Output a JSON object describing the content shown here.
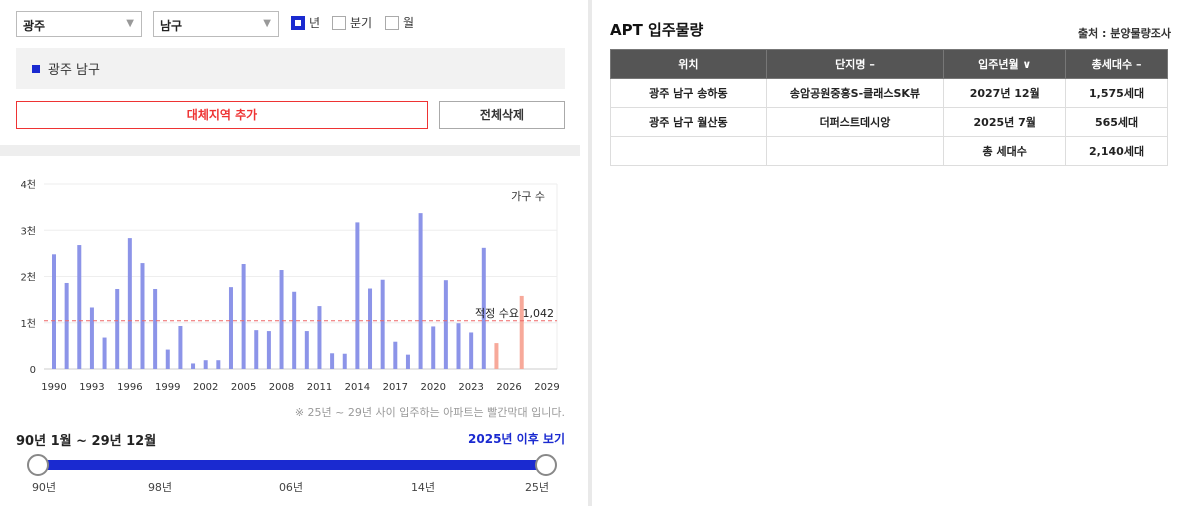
{
  "filters": {
    "province": "광주",
    "district": "남구",
    "period_options": [
      {
        "label": "년",
        "checked": true
      },
      {
        "label": "분기",
        "checked": false
      },
      {
        "label": "월",
        "checked": false
      }
    ]
  },
  "selected_region": "광주 남구",
  "buttons": {
    "add_region": "대체지역 추가",
    "delete_all": "전체삭제"
  },
  "chart_data": {
    "type": "bar",
    "ylabel": "가구 수",
    "yticks": [
      "0",
      "1천",
      "2천",
      "3천",
      "4천"
    ],
    "ylim": [
      0,
      4000
    ],
    "xticks": [
      "1990",
      "1993",
      "1996",
      "1999",
      "2002",
      "2005",
      "2008",
      "2011",
      "2014",
      "2017",
      "2020",
      "2023",
      "2026",
      "2029"
    ],
    "x": [
      1990,
      1991,
      1992,
      1993,
      1994,
      1995,
      1996,
      1997,
      1998,
      1999,
      2000,
      2001,
      2002,
      2003,
      2004,
      2005,
      2006,
      2007,
      2008,
      2009,
      2010,
      2011,
      2012,
      2013,
      2014,
      2015,
      2016,
      2017,
      2018,
      2019,
      2020,
      2021,
      2022,
      2023,
      2024,
      2025,
      2026,
      2027,
      2028,
      2029
    ],
    "values": [
      2480,
      1860,
      2680,
      1330,
      680,
      1730,
      2830,
      2290,
      1730,
      420,
      930,
      120,
      190,
      190,
      1770,
      2270,
      840,
      820,
      2140,
      1670,
      820,
      1360,
      340,
      330,
      3170,
      1740,
      1930,
      590,
      310,
      3370,
      920,
      1920,
      990,
      790,
      2620,
      560,
      0,
      1580,
      0,
      0
    ],
    "future_from": 2025,
    "reference_line": {
      "label": "적정 수요 1,042",
      "value": 1042
    },
    "colors": {
      "past": "#8c94e8",
      "future": "#f7a99a",
      "reference": "#e66"
    }
  },
  "note": "※ 25년 ~ 29년 사이 입주하는 아파트는 빨간막대 입니다.",
  "range": {
    "label": "90년 1월 ~ 29년 12월",
    "after_link": "2025년 이후 보기",
    "tick_labels": [
      "90년",
      "98년",
      "06년",
      "14년",
      "25년"
    ]
  },
  "right": {
    "title": "APT 입주물량",
    "source": "출처 : 분양물량조사",
    "columns": [
      "위치",
      "단지명 –",
      "입주년월 ∨",
      "총세대수 –"
    ],
    "rows": [
      [
        "광주 남구 송하동",
        "송암공원중흥S-클래스SK뷰",
        "2027년 12월",
        "1,575세대"
      ],
      [
        "광주 남구 월산동",
        "더퍼스트데시앙",
        "2025년 7월",
        "565세대"
      ],
      [
        "",
        "",
        "총 세대수",
        "2,140세대"
      ]
    ]
  }
}
